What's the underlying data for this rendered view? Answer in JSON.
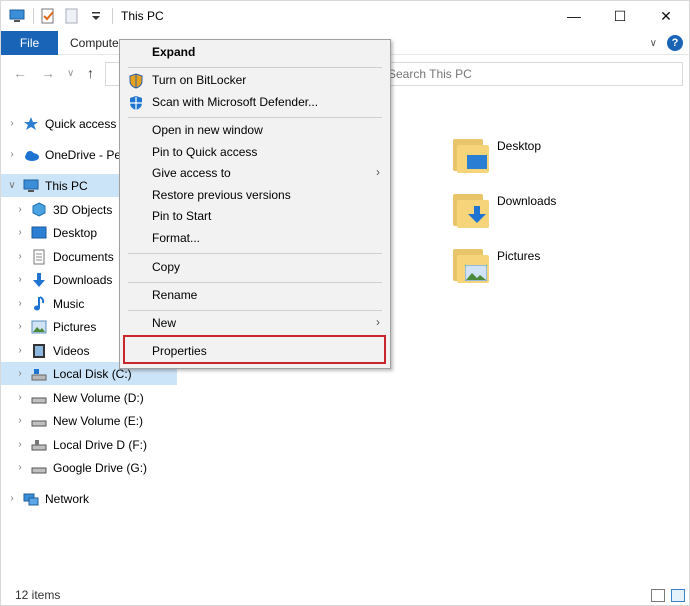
{
  "window": {
    "title": "This PC",
    "controls": {
      "minimize": "—",
      "maximize": "☐",
      "close": "✕"
    }
  },
  "ribbon": {
    "file_tab": "File",
    "computer_tab": "Computer",
    "expand_chevron": "∨",
    "help": "?"
  },
  "navbar": {
    "back": "←",
    "forward": "→",
    "recent": "∨",
    "up": "↑",
    "search_placeholder": "Search This PC"
  },
  "navpane": {
    "items": [
      {
        "label": "Quick access",
        "chev": "›",
        "icon": "star-icon",
        "selected": false
      },
      {
        "label": "OneDrive - Pe",
        "chev": "›",
        "icon": "cloud-icon",
        "selected": false
      },
      {
        "label": "This PC",
        "chev": "∨",
        "icon": "computer-icon",
        "selected": true
      },
      {
        "label": "3D Objects",
        "chev": "›",
        "icon": "cube-icon",
        "selected": false
      },
      {
        "label": "Desktop",
        "chev": "›",
        "icon": "desktop-folder-icon",
        "selected": false
      },
      {
        "label": "Documents",
        "chev": "›",
        "icon": "documents-icon",
        "selected": false
      },
      {
        "label": "Downloads",
        "chev": "›",
        "icon": "download-icon",
        "selected": false
      },
      {
        "label": "Music",
        "chev": "›",
        "icon": "music-icon",
        "selected": false
      },
      {
        "label": "Pictures",
        "chev": "›",
        "icon": "pictures-icon",
        "selected": false
      },
      {
        "label": "Videos",
        "chev": "›",
        "icon": "videos-icon",
        "selected": false
      },
      {
        "label": "Local Disk (C:)",
        "chev": "›",
        "icon": "local-disk-icon",
        "selected": true
      },
      {
        "label": "New Volume (D:)",
        "chev": "›",
        "icon": "drive-icon",
        "selected": false
      },
      {
        "label": "New Volume (E:)",
        "chev": "›",
        "icon": "drive-icon",
        "selected": false
      },
      {
        "label": "Local Drive D (F:)",
        "chev": "›",
        "icon": "usb-drive-icon",
        "selected": false
      },
      {
        "label": "Google Drive (G:)",
        "chev": "›",
        "icon": "drive-icon",
        "selected": false
      },
      {
        "label": "Network",
        "chev": "›",
        "icon": "network-icon",
        "selected": false
      }
    ]
  },
  "content": {
    "folders": [
      {
        "label": "Desktop",
        "icon": "desktop-folder-icon"
      },
      {
        "label": "Downloads",
        "icon": "downloads-folder-icon"
      },
      {
        "label": "Pictures",
        "icon": "pictures-folder-icon"
      }
    ]
  },
  "context_menu": {
    "items": [
      {
        "label": "Expand",
        "bold": true
      },
      {
        "label": "Turn on BitLocker",
        "icon": "shield-icon"
      },
      {
        "label": "Scan with Microsoft Defender...",
        "icon": "defender-icon"
      },
      {
        "label": "Open in new window"
      },
      {
        "label": "Pin to Quick access"
      },
      {
        "label": "Give access to",
        "submenu": "›"
      },
      {
        "label": "Restore previous versions"
      },
      {
        "label": "Pin to Start"
      },
      {
        "label": "Format..."
      },
      {
        "label": "Copy"
      },
      {
        "label": "Rename"
      },
      {
        "label": "New",
        "submenu": "›"
      },
      {
        "label": "Properties",
        "highlighted": true
      }
    ]
  },
  "statusbar": {
    "count": "12 items"
  },
  "colors": {
    "accent": "#1a64b8",
    "selection": "#cce4f7",
    "highlight_border": "#c9262c",
    "folder": "#f5d47a"
  }
}
